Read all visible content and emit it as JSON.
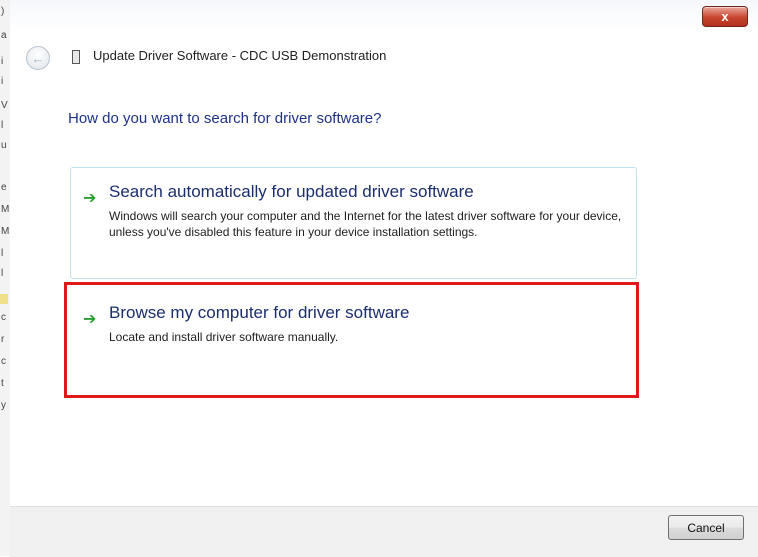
{
  "window": {
    "title": "Update Driver Software - CDC USB Demonstration",
    "close_label": "x"
  },
  "main": {
    "heading": "How do you want to search for driver software?",
    "options": [
      {
        "title": "Search automatically for updated driver software",
        "description": "Windows will search your computer and the Internet for the latest driver software for your device, unless you've disabled this feature in your device installation settings."
      },
      {
        "title": "Browse my computer for driver software",
        "description": "Locate and install driver software manually."
      }
    ]
  },
  "footer": {
    "cancel_label": "Cancel"
  },
  "icons": {
    "arrow": "green-arrow-icon",
    "back": "back-arrow-icon",
    "device": "usb-device-icon"
  },
  "colors": {
    "heading": "#1e3287",
    "highlight_box": "#e11818",
    "arrow": "#28a030"
  }
}
